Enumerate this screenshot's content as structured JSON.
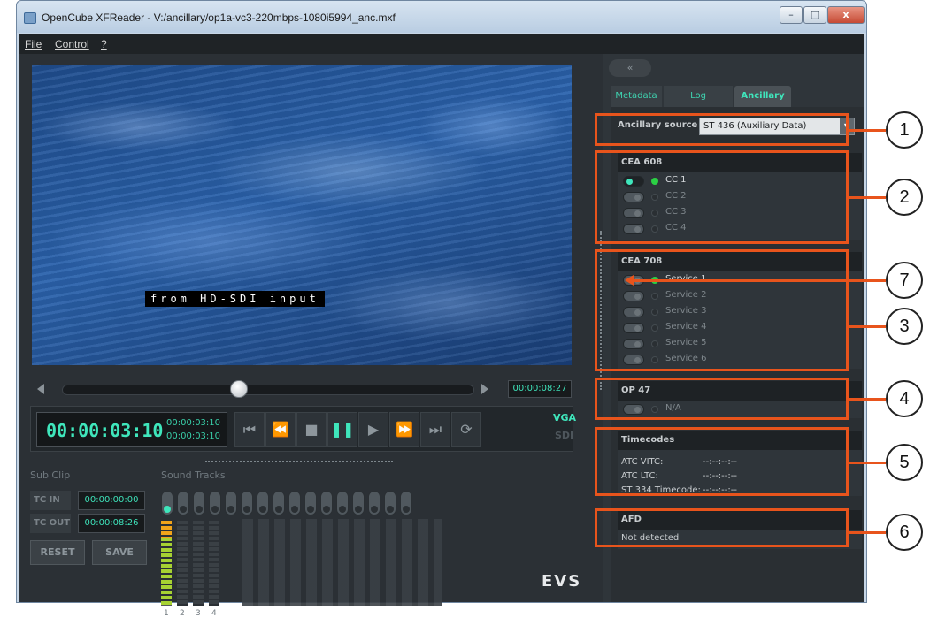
{
  "window": {
    "title": "OpenCube XFReader - V:/ancillary/op1a-vc3-220mbps-1080i5994_anc.mxf",
    "min": "–",
    "max": "□",
    "close": "x"
  },
  "menu": [
    {
      "label": "File"
    },
    {
      "label": "Control"
    },
    {
      "label": "?"
    }
  ],
  "video": {
    "caption": "from HD-SDI input"
  },
  "player": {
    "duration": "00:00:08:27",
    "position_fraction": 0.43,
    "timecode": "00:00:03:10",
    "tc_in": "00:00:03:10",
    "tc_out": "00:00:03:10",
    "vga": "VGA",
    "sdi": "SDI",
    "controls": [
      "⏮",
      "⏪",
      "■",
      "❚❚",
      "▶",
      "⏩",
      "⏭",
      "⟳"
    ]
  },
  "subclip": {
    "label": "Sub Clip",
    "tc_in_label": "TC IN",
    "tc_in": "00:00:00:00",
    "tc_out_label": "TC OUT",
    "tc_out": "00:00:08:26",
    "reset": "RESET",
    "save": "SAVE"
  },
  "sound": {
    "label": "Sound Tracks",
    "meter_numbers": [
      "1",
      "2",
      "3",
      "4"
    ]
  },
  "brand": "EVS",
  "panel": {
    "collapse": "«",
    "tabs": [
      {
        "label": "Metadata"
      },
      {
        "label": "Log"
      },
      {
        "label": "Ancillary"
      }
    ],
    "ancillary_source_label": "Ancillary source",
    "ancillary_source_value": "ST 436 (Auxiliary Data)",
    "cea608": {
      "title": "CEA 608",
      "items": [
        {
          "label": "CC 1"
        },
        {
          "label": "CC 2"
        },
        {
          "label": "CC 3"
        },
        {
          "label": "CC 4"
        }
      ]
    },
    "cea708": {
      "title": "CEA 708",
      "items": [
        {
          "label": "Service 1"
        },
        {
          "label": "Service 2"
        },
        {
          "label": "Service 3"
        },
        {
          "label": "Service 4"
        },
        {
          "label": "Service 5"
        },
        {
          "label": "Service 6"
        }
      ]
    },
    "op47": {
      "title": "OP 47",
      "item": "N/A"
    },
    "timecodes": {
      "title": "Timecodes",
      "atc_vitc_label": "ATC VITC:",
      "atc_vitc": "--:--:--:--",
      "atc_ltc_label": "ATC LTC:",
      "atc_ltc": "--:--:--:--",
      "st334_label": "ST 334 Timecode:",
      "st334": "--:--:--:--"
    },
    "afd": {
      "title": "AFD",
      "value": "Not detected"
    }
  },
  "callouts": [
    "1",
    "2",
    "3",
    "4",
    "5",
    "6",
    "7"
  ]
}
